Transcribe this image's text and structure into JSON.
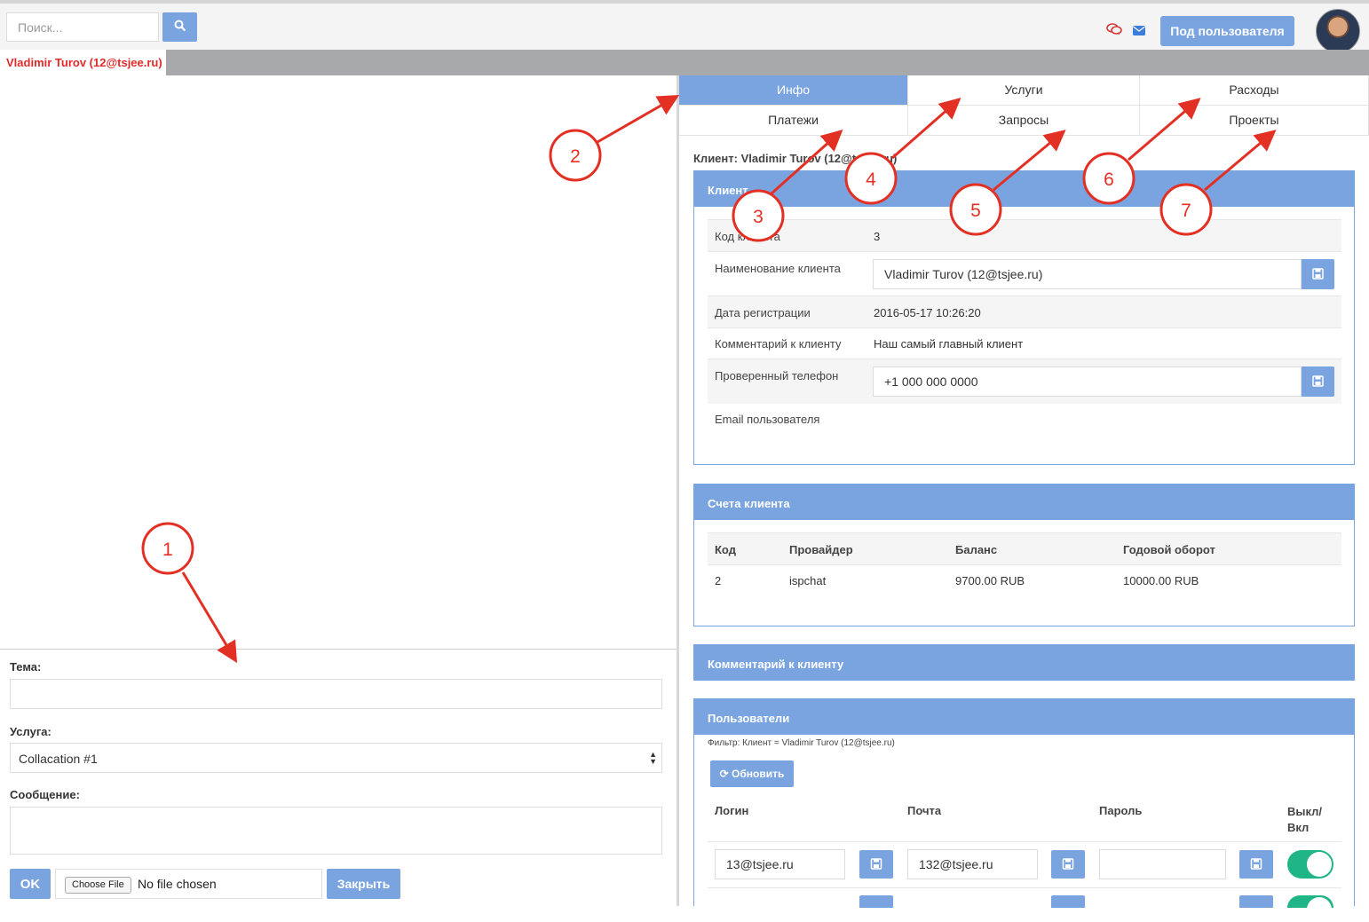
{
  "search": {
    "placeholder": "Поиск..."
  },
  "header": {
    "impersonate_label": "Под пользователя"
  },
  "doc_tab": {
    "label": "Vladimir Turov (12@tsjee.ru)"
  },
  "compose": {
    "subject_label": "Тема:",
    "service_label": "Услуга:",
    "service_value": "Collacation #1",
    "message_label": "Сообщение:",
    "ok_label": "OK",
    "choose_file_label": "Choose File",
    "no_file_label": "No file chosen",
    "close_label": "Закрыть"
  },
  "tabs": [
    {
      "label": "Инфо",
      "active": true
    },
    {
      "label": "Услуги"
    },
    {
      "label": "Расходы"
    },
    {
      "label": "Платежи"
    },
    {
      "label": "Запросы"
    },
    {
      "label": "Проекты"
    }
  ],
  "client_heading": "Клиент: Vladimir Turov (12@tsjee.ru)",
  "client_panel": {
    "title": "Клиент",
    "rows": [
      {
        "label": "Код клиента",
        "value": "3"
      },
      {
        "label": "Наименование клиента",
        "value": "Vladimir Turov (12@tsjee.ru)"
      },
      {
        "label": "Дата регистрации",
        "value": "2016-05-17 10:26:20"
      },
      {
        "label": "Комментарий к клиенту",
        "value": "Наш самый главный клиент"
      },
      {
        "label": "Проверенный телефон",
        "value": "+1 000 000 0000"
      },
      {
        "label": "Email пользователя",
        "value": ""
      }
    ]
  },
  "accounts_panel": {
    "title": "Счета клиента",
    "columns": [
      "Код",
      "Провайдер",
      "Баланс",
      "Годовой оборот"
    ],
    "rows": [
      [
        "2",
        "ispchat",
        "9700.00 RUB",
        "10000.00 RUB"
      ]
    ]
  },
  "comment_panel": {
    "title": "Комментарий к клиенту"
  },
  "users_panel": {
    "title": "Пользователи",
    "filter": "Фильтр: Клиент = Vladimir Turov (12@tsjee.ru)",
    "refresh_label": "Обновить",
    "columns": [
      "Логин",
      "Почта",
      "Пароль",
      "Выкл/\nВкл"
    ],
    "rows": [
      {
        "login": "13@tsjee.ru",
        "email": "132@tsjee.ru",
        "password": "",
        "enabled": true
      }
    ]
  },
  "callouts": [
    "1",
    "2",
    "3",
    "4",
    "5",
    "6",
    "7"
  ],
  "colors": {
    "accent": "#7aa4e0",
    "annotation": "#e33025",
    "doc_tab_text": "#e22a2a",
    "toggle_on": "#20b586"
  },
  "icons": [
    "search-icon",
    "chat-icon",
    "mail-icon",
    "save-icon",
    "refresh-icon",
    "select-arrows-icon"
  ]
}
